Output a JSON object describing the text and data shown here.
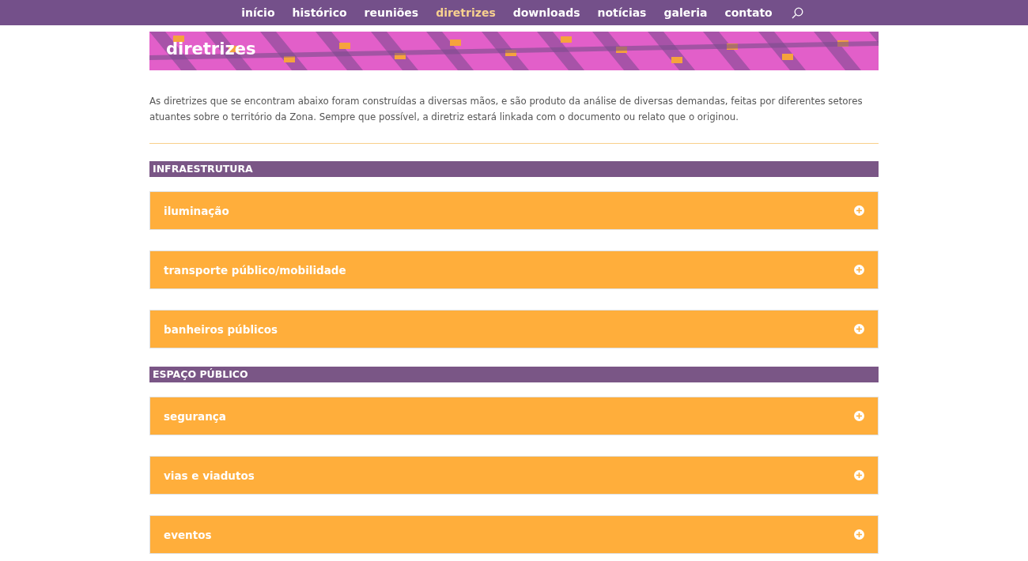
{
  "nav": {
    "items": [
      {
        "label": "início",
        "selected": false
      },
      {
        "label": "histórico",
        "selected": false
      },
      {
        "label": "reuniões",
        "selected": false
      },
      {
        "label": "diretrizes",
        "selected": true
      },
      {
        "label": "downloads",
        "selected": false
      },
      {
        "label": "notícias",
        "selected": false
      },
      {
        "label": "galeria",
        "selected": false
      },
      {
        "label": "contato",
        "selected": false
      }
    ]
  },
  "banner": {
    "title": "diretrizes"
  },
  "intro": "As diretrizes que se encontram abaixo foram construídas a diversas mãos, e são produto da análise de diversas demandas, feitas por diferentes setores atuantes sobre o território da Zona. Sempre que possível, a diretriz estará linkada com o documento ou relato que o originou.",
  "sections": [
    {
      "heading": "INFRAESTRUTURA",
      "toggles": [
        {
          "title": "iluminação",
          "expanded": false
        },
        {
          "title": "transporte público/mobilidade",
          "expanded": false
        },
        {
          "title": "banheiros públicos",
          "expanded": false
        }
      ]
    },
    {
      "heading": "ESPAÇO PÚBLICO",
      "toggles": [
        {
          "title": "segurança",
          "expanded": false
        },
        {
          "title": "vias e viadutos",
          "expanded": false
        },
        {
          "title": "eventos",
          "expanded": false
        }
      ]
    }
  ]
}
